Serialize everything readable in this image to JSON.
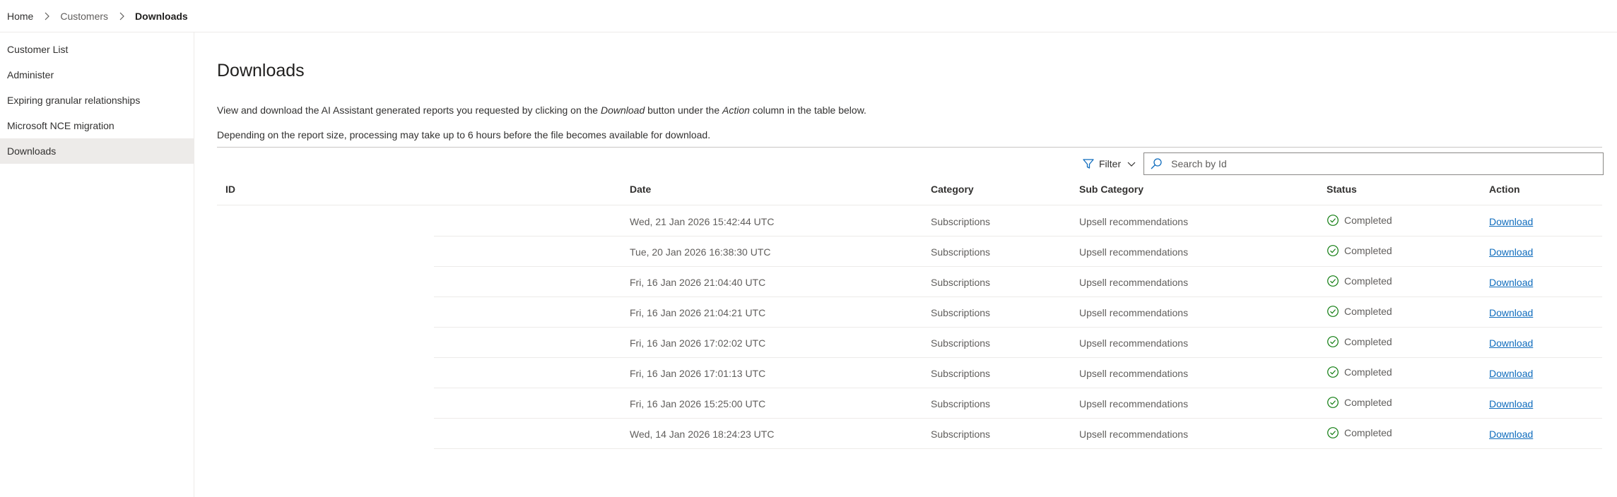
{
  "breadcrumb": {
    "home": "Home",
    "customers": "Customers",
    "current": "Downloads"
  },
  "sidebar": {
    "items": [
      {
        "label": "Customer List"
      },
      {
        "label": "Administer"
      },
      {
        "label": "Expiring granular relationships"
      },
      {
        "label": "Microsoft NCE migration"
      },
      {
        "label": "Downloads",
        "active": true
      }
    ]
  },
  "main": {
    "title": "Downloads",
    "desc1_pre": "View and download the AI Assistant generated reports you requested by clicking on the ",
    "desc1_em1": "Download",
    "desc1_mid": " button under the ",
    "desc1_em2": "Action",
    "desc1_post": " column in the table below.",
    "desc2": "Depending on the report size, processing may take up to 6 hours before the file becomes available for download."
  },
  "toolbar": {
    "filter_label": "Filter",
    "search_placeholder": "Search by Id",
    "search_value": ""
  },
  "table": {
    "headers": {
      "id": "ID",
      "date": "Date",
      "category": "Category",
      "sub_category": "Sub Category",
      "status": "Status",
      "action": "Action"
    },
    "rows": [
      {
        "id": "",
        "date": "Wed, 21 Jan 2026 15:42:44 UTC",
        "category": "Subscriptions",
        "sub_category": "Upsell recommendations",
        "status": "Completed",
        "action": "Download"
      },
      {
        "id": "",
        "date": "Tue, 20 Jan 2026 16:38:30 UTC",
        "category": "Subscriptions",
        "sub_category": "Upsell recommendations",
        "status": "Completed",
        "action": "Download"
      },
      {
        "id": "",
        "date": "Fri, 16 Jan 2026 21:04:40 UTC",
        "category": "Subscriptions",
        "sub_category": "Upsell recommendations",
        "status": "Completed",
        "action": "Download"
      },
      {
        "id": "",
        "date": "Fri, 16 Jan 2026 21:04:21 UTC",
        "category": "Subscriptions",
        "sub_category": "Upsell recommendations",
        "status": "Completed",
        "action": "Download"
      },
      {
        "id": "",
        "date": "Fri, 16 Jan 2026 17:02:02 UTC",
        "category": "Subscriptions",
        "sub_category": "Upsell recommendations",
        "status": "Completed",
        "action": "Download"
      },
      {
        "id": "",
        "date": "Fri, 16 Jan 2026 17:01:13 UTC",
        "category": "Subscriptions",
        "sub_category": "Upsell recommendations",
        "status": "Completed",
        "action": "Download"
      },
      {
        "id": "",
        "date": "Fri, 16 Jan 2026 15:25:00 UTC",
        "category": "Subscriptions",
        "sub_category": "Upsell recommendations",
        "status": "Completed",
        "action": "Download"
      },
      {
        "id": "",
        "date": "Wed, 14 Jan 2026 18:24:23 UTC",
        "category": "Subscriptions",
        "sub_category": "Upsell recommendations",
        "status": "Completed",
        "action": "Download"
      }
    ]
  },
  "icons": {
    "chevron_right": "chevron-right-icon",
    "filter": "filter-icon",
    "chevron_down": "chevron-down-icon",
    "search": "search-icon",
    "completed": "check-circle-icon"
  },
  "colors": {
    "link": "#0f6cbd",
    "success": "#107c10",
    "active_nav": "#edebe9"
  }
}
